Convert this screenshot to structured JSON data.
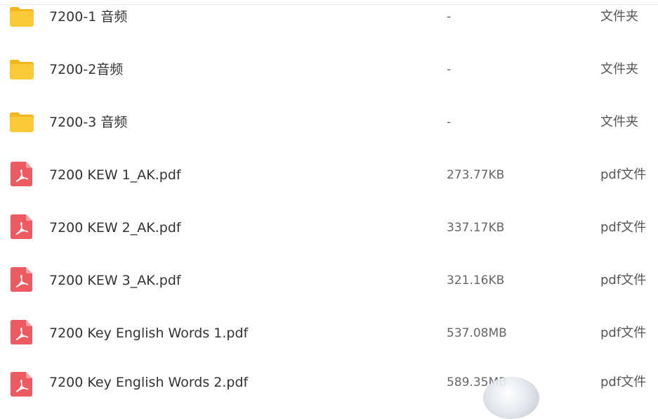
{
  "colors": {
    "folder": "#F9C938",
    "folder_tab": "#F2B620",
    "pdf": "#EE5A62",
    "text": "#333333",
    "meta_text": "#666666"
  },
  "files": [
    {
      "name": "7200-1 音频",
      "size": "-",
      "type": "文件夹",
      "icon": "folder-icon"
    },
    {
      "name": "7200-2音频",
      "size": "-",
      "type": "文件夹",
      "icon": "folder-icon"
    },
    {
      "name": "7200-3 音频",
      "size": "-",
      "type": "文件夹",
      "icon": "folder-icon"
    },
    {
      "name": "7200 KEW 1_AK.pdf",
      "size": "273.77KB",
      "type": "pdf文件",
      "icon": "pdf-icon"
    },
    {
      "name": "7200 KEW 2_AK.pdf",
      "size": "337.17KB",
      "type": "pdf文件",
      "icon": "pdf-icon"
    },
    {
      "name": "7200 KEW 3_AK.pdf",
      "size": "321.16KB",
      "type": "pdf文件",
      "icon": "pdf-icon"
    },
    {
      "name": "7200 Key English Words 1.pdf",
      "size": "537.08MB",
      "type": "pdf文件",
      "icon": "pdf-icon"
    },
    {
      "name": "7200 Key English Words 2.pdf",
      "size": "589.35MB",
      "type": "pdf文件",
      "icon": "pdf-icon"
    }
  ]
}
